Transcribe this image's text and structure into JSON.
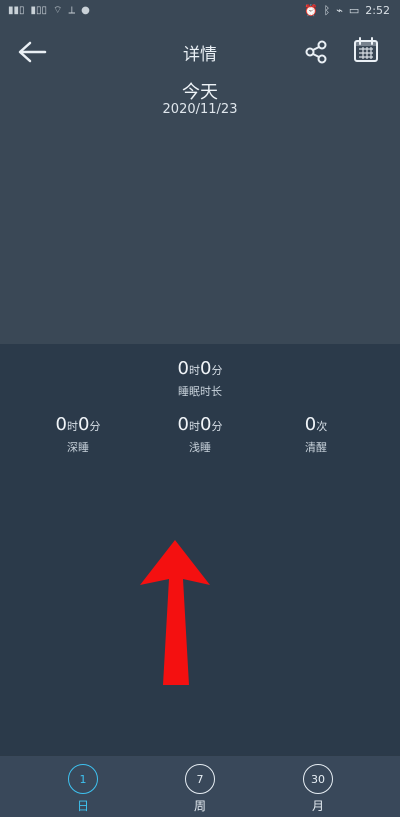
{
  "status_bar": {
    "left_indicators": [
      "■□",
      "■□",
      "■",
      "■"
    ],
    "time": "2:52"
  },
  "header": {
    "title": "详情"
  },
  "date_block": {
    "day": "今天",
    "date": "2020/11/23"
  },
  "summary": {
    "total": {
      "h": "0",
      "h_unit": "时",
      "m": "0",
      "m_unit": "分",
      "label": "睡眠时长"
    },
    "deep": {
      "h": "0",
      "h_unit": "时",
      "m": "0",
      "m_unit": "分",
      "label": "深睡"
    },
    "light": {
      "h": "0",
      "h_unit": "时",
      "m": "0",
      "m_unit": "分",
      "label": "浅睡"
    },
    "awake": {
      "count": "0",
      "count_unit": "次",
      "label": "清醒"
    }
  },
  "bottom_nav": {
    "day": {
      "badge": "1",
      "label": "日"
    },
    "week": {
      "badge": "7",
      "label": "周"
    },
    "month": {
      "badge": "30",
      "label": "月"
    }
  },
  "colors": {
    "accent": "#3ec2f0",
    "arrow": "#f41010"
  },
  "icons": {
    "back": "back-arrow-icon",
    "share": "share-icon",
    "calendar": "calendar-icon"
  }
}
